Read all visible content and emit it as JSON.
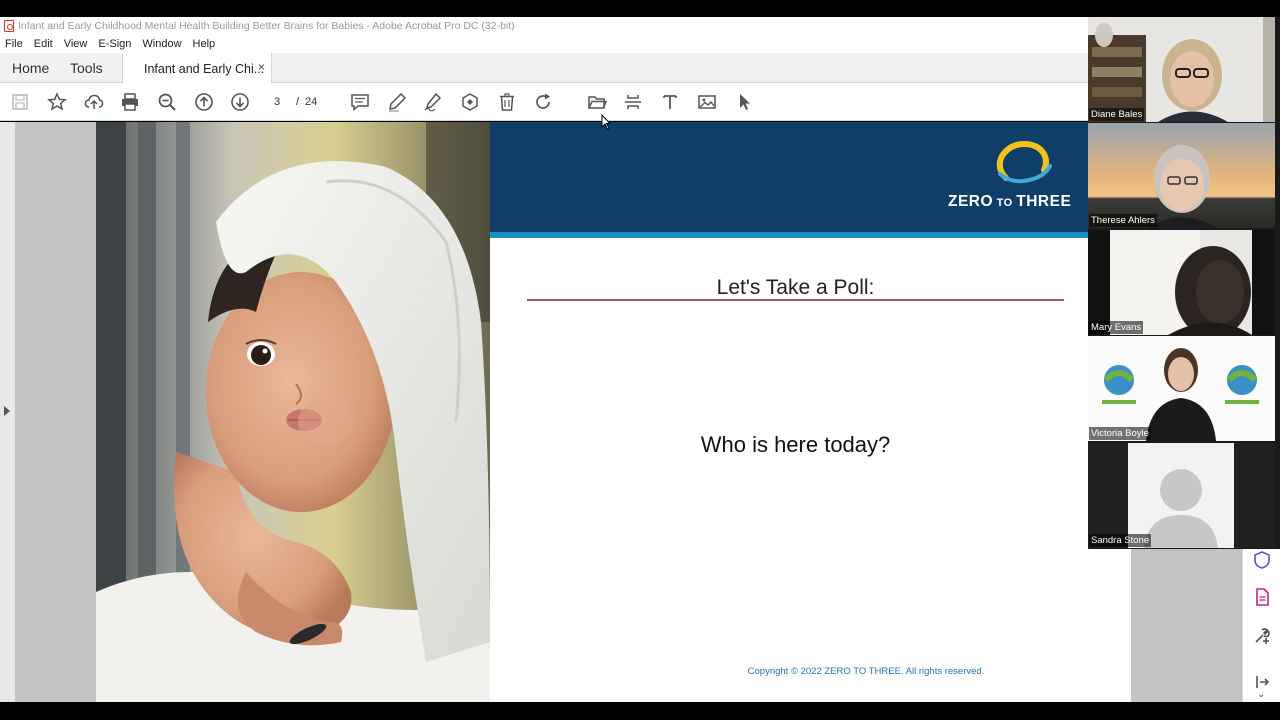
{
  "window": {
    "title": "Infant and Early Childhood Mental Health  Building Better Brains for Babies - Adobe Acrobat Pro DC (32-bit)"
  },
  "menu": [
    "File",
    "Edit",
    "View",
    "E-Sign",
    "Window",
    "Help"
  ],
  "tabs": {
    "home": "Home",
    "tools": "Tools",
    "document": "Infant and Early Chi...",
    "close_glyph": "×"
  },
  "toolbar": {
    "current_page": "3",
    "separator": "/",
    "total_pages": "24"
  },
  "slide": {
    "logo_text": "ZERO TO THREE",
    "logo_main": "ZERO",
    "logo_small": " TO ",
    "logo_end": "THREE",
    "title": "Let's Take a Poll:",
    "question": "Who is here today?",
    "copyright": "Copyright © 2022 ZERO TO THREE. All rights reserved."
  },
  "participants": [
    {
      "name": "Diane Bales"
    },
    {
      "name": "Therese Ahlers"
    },
    {
      "name": "Mary Evans"
    },
    {
      "name": "Victoria Boyle"
    },
    {
      "name": "Sandra Stone"
    }
  ],
  "colors": {
    "banner": "#0f3f68",
    "banner_stripe": "#1a8fc7",
    "poll_rule": "#a3576b",
    "copyright": "#2474b5"
  }
}
